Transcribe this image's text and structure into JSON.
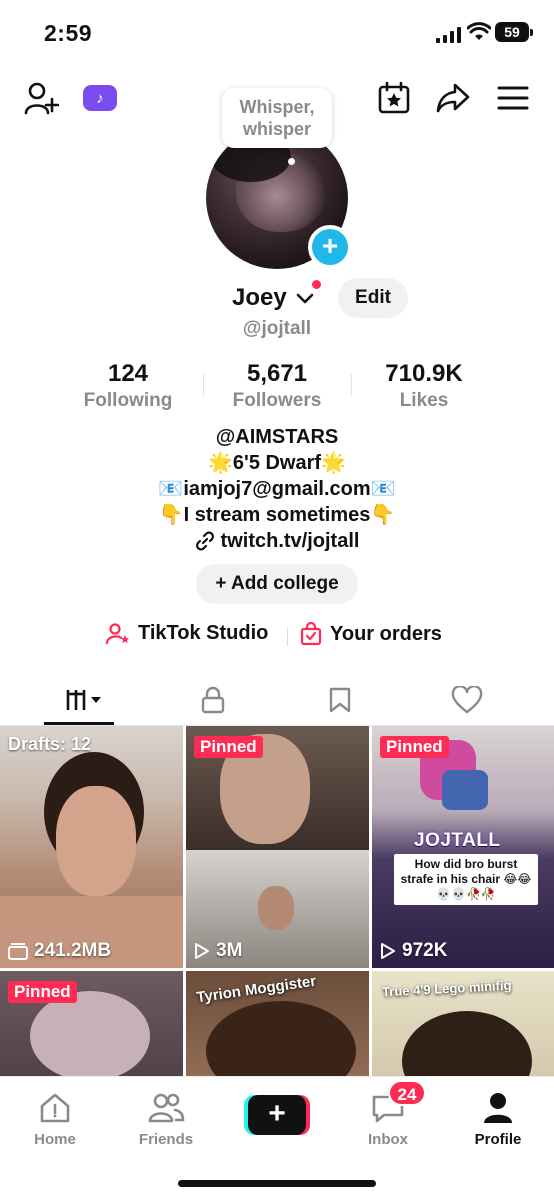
{
  "status_bar": {
    "time": "2:59",
    "battery": "59"
  },
  "top_bar": {
    "tiktok_badge": "♪"
  },
  "profile": {
    "bubble_text": "Whisper, whisper",
    "name": "Joey",
    "edit_label": "Edit",
    "handle": "@jojtall"
  },
  "stats": [
    {
      "value": "124",
      "label": "Following"
    },
    {
      "value": "5,671",
      "label": "Followers"
    },
    {
      "value": "710.9K",
      "label": "Likes"
    }
  ],
  "bio": {
    "line1": "@AIMSTARS",
    "line2": "🌟6'5 Dwarf🌟",
    "line3": "📧iamjoj7@gmail.com📧",
    "line4": "👇I stream sometimes👇",
    "link": "twitch.tv/jojtall"
  },
  "add_college": "+ Add college",
  "shortcuts": {
    "studio": "TikTok Studio",
    "orders": "Your orders"
  },
  "grid": {
    "drafts": "Drafts: 12",
    "drafts_size": "241.2MB",
    "pinned": "Pinned",
    "views_2": "3M",
    "views_3": "972K",
    "stream_tag": "JOJTALL",
    "caption_3": "How did bro burst strafe in his chair 😂😂💀💀🥀🥀",
    "caption_5": "Tyrion Moggister",
    "caption_6": "True 4'9 Lego minifig",
    "social_handle": "jojtall"
  },
  "bottom_nav": {
    "home": "Home",
    "friends": "Friends",
    "create": "+",
    "inbox": "Inbox",
    "inbox_badge": "24",
    "profile": "Profile"
  },
  "colors": {
    "accent": "#fe2c55",
    "cyan": "#25f4ee",
    "blue": "#20b8e8",
    "purple": "#7a4cf0"
  }
}
